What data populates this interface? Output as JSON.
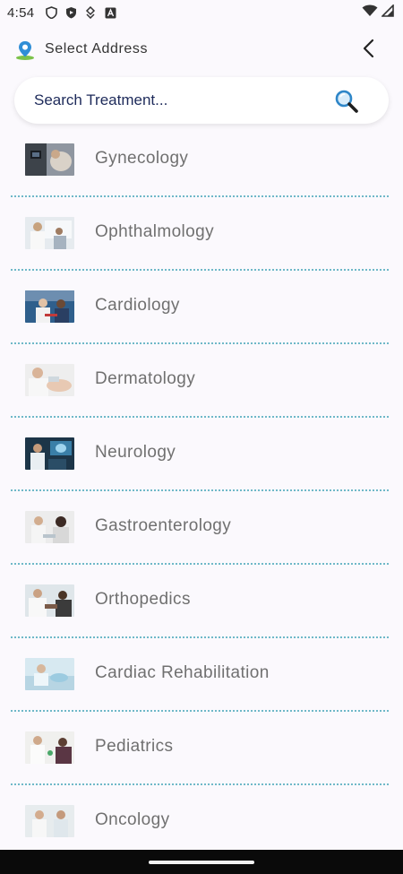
{
  "status_bar": {
    "time": "4:54",
    "left_icons": [
      "shield-icon",
      "play-protect-icon",
      "data-saver-icon",
      "font-icon"
    ],
    "right_icons": [
      "wifi-icon",
      "signal-icon"
    ]
  },
  "header": {
    "title": "Select Address",
    "location_icon": "location-pin-icon",
    "back_icon": "chevron-left-icon"
  },
  "search": {
    "placeholder": "Search Treatment...",
    "icon": "search-icon"
  },
  "colors": {
    "background": "#fbf9fd",
    "divider": "#6fb8c8",
    "search_text": "#1d2a5a",
    "item_text": "#707070"
  },
  "treatments": [
    {
      "label": "Gynecology",
      "thumb": "gynecology-image"
    },
    {
      "label": "Ophthalmology",
      "thumb": "ophthalmology-image"
    },
    {
      "label": "Cardiology",
      "thumb": "cardiology-image"
    },
    {
      "label": "Dermatology",
      "thumb": "dermatology-image"
    },
    {
      "label": "Neurology",
      "thumb": "neurology-image"
    },
    {
      "label": "Gastroenterology",
      "thumb": "gastroenterology-image"
    },
    {
      "label": "Orthopedics",
      "thumb": "orthopedics-image"
    },
    {
      "label": "Cardiac Rehabilitation",
      "thumb": "cardiac-rehabilitation-image"
    },
    {
      "label": "Pediatrics",
      "thumb": "pediatrics-image"
    },
    {
      "label": "Oncology",
      "thumb": "oncology-image"
    }
  ]
}
